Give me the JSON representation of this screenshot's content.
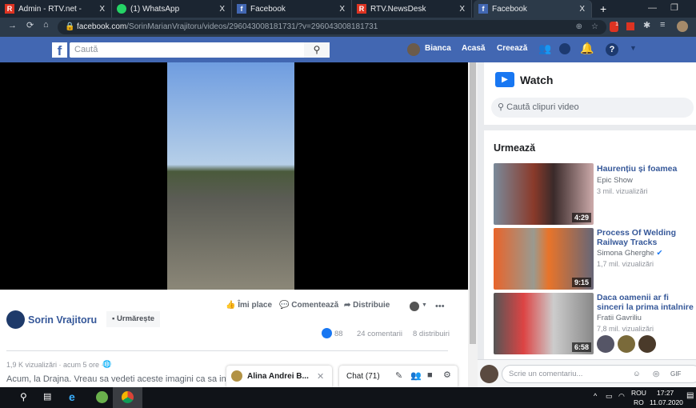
{
  "browser": {
    "tabs": [
      {
        "title": "Admin - RTV.net -",
        "icon": "rtv-icon"
      },
      {
        "title": "(1) WhatsApp",
        "icon": "whatsapp-icon"
      },
      {
        "title": "Facebook",
        "icon": "facebook-icon"
      },
      {
        "title": "RTV.NewsDesk",
        "icon": "rtv-icon"
      },
      {
        "title": "Facebook",
        "icon": "facebook-icon",
        "active": true
      }
    ],
    "close": "X",
    "new_tab": "+",
    "url_domain": "facebook.com",
    "url_path": "/SorinMarianVrajitoru/videos/296043008181731/?v=296043008181731",
    "ext_badge": "1"
  },
  "fb_header": {
    "search_placeholder": "Caută",
    "user": "Bianca",
    "home": "Acasă",
    "create": "Creează",
    "help": "?"
  },
  "post": {
    "author": "Sorin Vrajitoru",
    "follow": "Urmărește",
    "actions": {
      "like": "Îmi place",
      "comment": "Comentează",
      "share": "Distribuie",
      "more": "•••"
    },
    "likes": "88",
    "comments": "24 comentarii",
    "shares": "8 distribuiri",
    "meta": "1,9 K vizualizări · acum 5 ore ·",
    "text": "Acum, la Drajna. Vreau sa vedeti aceste imagini ca sa intelegeti p"
  },
  "chat": {
    "contact": "Alina Andrei B...",
    "close": "✕",
    "label": "Chat (71)"
  },
  "watch": {
    "title": "Watch",
    "search_placeholder": "Caută clipuri video",
    "up_next": "Urmează",
    "videos": [
      {
        "title": "Haurențiu și foamea",
        "channel": "Epic Show",
        "views": "3 mil. vizualizări",
        "duration": "4:29"
      },
      {
        "title": "Process Of Welding Railway Tracks",
        "channel": "Simona Gherghe",
        "verified": true,
        "views": "1,7 mil. vizualizări",
        "duration": "9:15"
      },
      {
        "title": "Daca oamenii ar fi sinceri la prima intalnire",
        "channel": "Fratii Gavriliu",
        "views": "7,8 mil. vizualizări",
        "duration": "6:58"
      }
    ],
    "comment_placeholder": "Scrie un comentariu..."
  },
  "taskbar": {
    "lang1": "ROU",
    "lang2": "RO",
    "time": "17:27",
    "date": "11.07.2020"
  },
  "colors": {
    "fb_blue": "#4267b2",
    "link": "#365899",
    "taskbar": "#101318"
  }
}
